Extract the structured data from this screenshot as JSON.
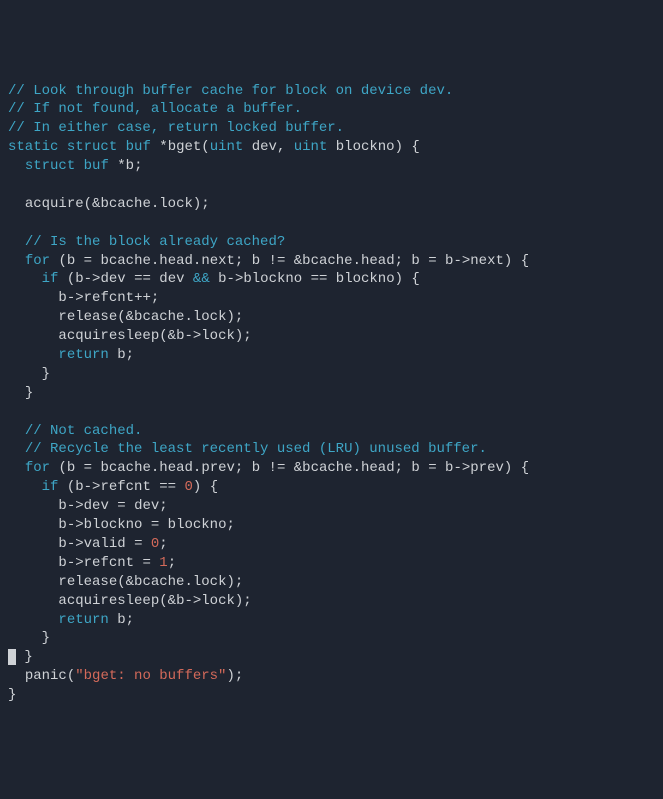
{
  "code": {
    "c1": "// Look through buffer cache for block on device dev.",
    "c2": "// If not found, allocate a buffer.",
    "c3": "// In either case, return locked buffer.",
    "kw_static": "static",
    "kw_struct": "struct",
    "typ_buf": "buf",
    "star": "*",
    "fn_bget": "bget",
    "lpar": "(",
    "rpar": ")",
    "typ_uint": "uint",
    "p_dev": "dev",
    "comma": ",",
    "p_blockno": "blockno",
    "lbrace": "{",
    "rbrace": "}",
    "decl_b": "b",
    "semi": ";",
    "fn_acquire": "acquire",
    "amp": "&",
    "id_bcache": "bcache",
    "dot": ".",
    "id_lock": "lock",
    "c4": "// Is the block already cached?",
    "kw_for": "for",
    "eq": "=",
    "id_head": "head",
    "id_next": "next",
    "id_prev": "prev",
    "neq": "!=",
    "arrow": "->",
    "kw_if": "if",
    "eqeq": "==",
    "andand": "&&",
    "id_refcnt": "refcnt",
    "plusplus": "++",
    "fn_release": "release",
    "fn_acquiresleep": "acquiresleep",
    "kw_return": "return",
    "c5": "// Not cached.",
    "c6": "// Recycle the least recently used (LRU) unused buffer.",
    "n0": "0",
    "n1": "1",
    "id_valid": "valid",
    "fn_panic": "panic",
    "str_panic": "\"bget: no buffers\""
  }
}
